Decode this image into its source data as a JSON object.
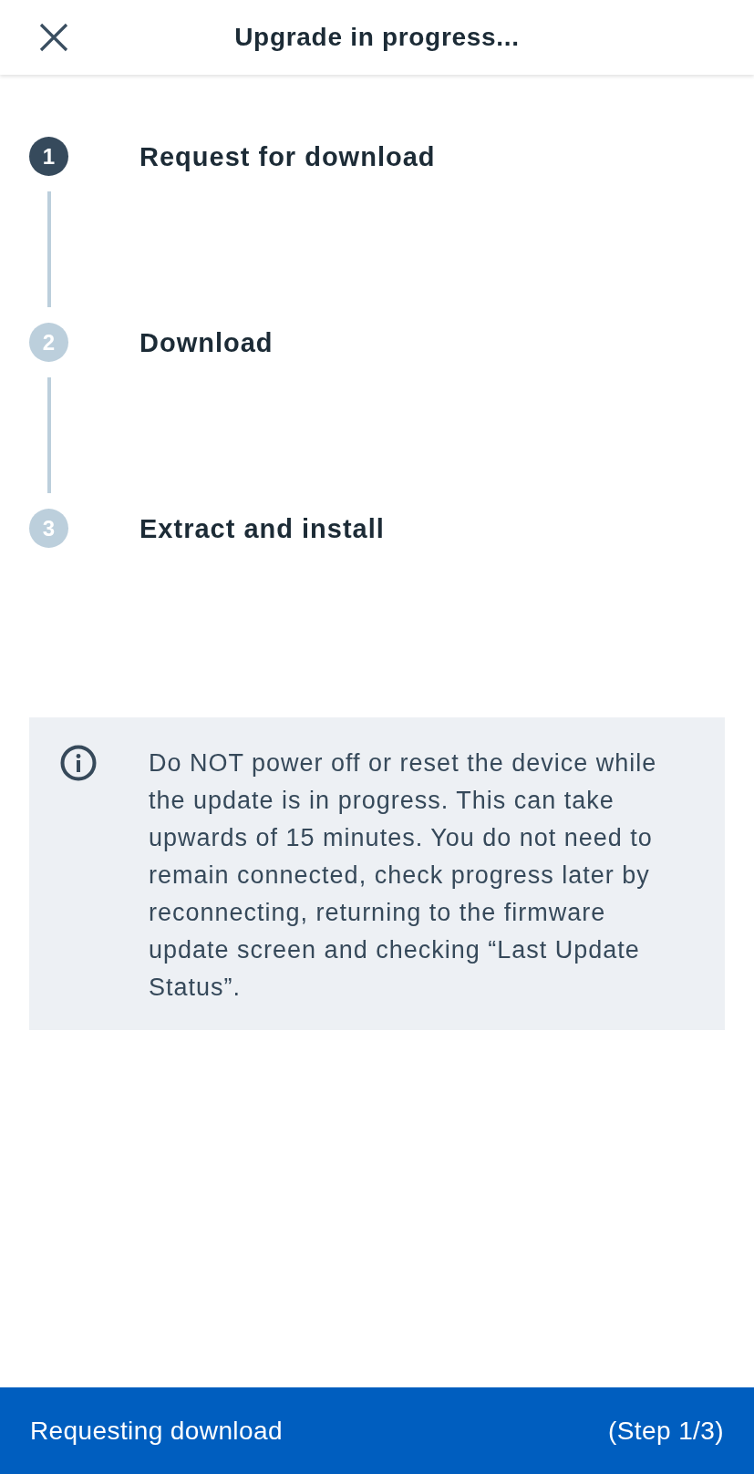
{
  "header": {
    "title": "Upgrade in progress..."
  },
  "steps": [
    {
      "number": "1",
      "label": "Request for download",
      "active": true
    },
    {
      "number": "2",
      "label": "Download",
      "active": false
    },
    {
      "number": "3",
      "label": "Extract and install",
      "active": false
    }
  ],
  "notice": {
    "text": "Do NOT power off or reset the device while the update is in progress. This can take upwards of 15 minutes. You do not need to remain connected, check progress later by reconnecting, returning to the firmware update screen and checking “Last Update Status”."
  },
  "status_bar": {
    "message": "Requesting download",
    "step": "(Step 1/3)"
  }
}
